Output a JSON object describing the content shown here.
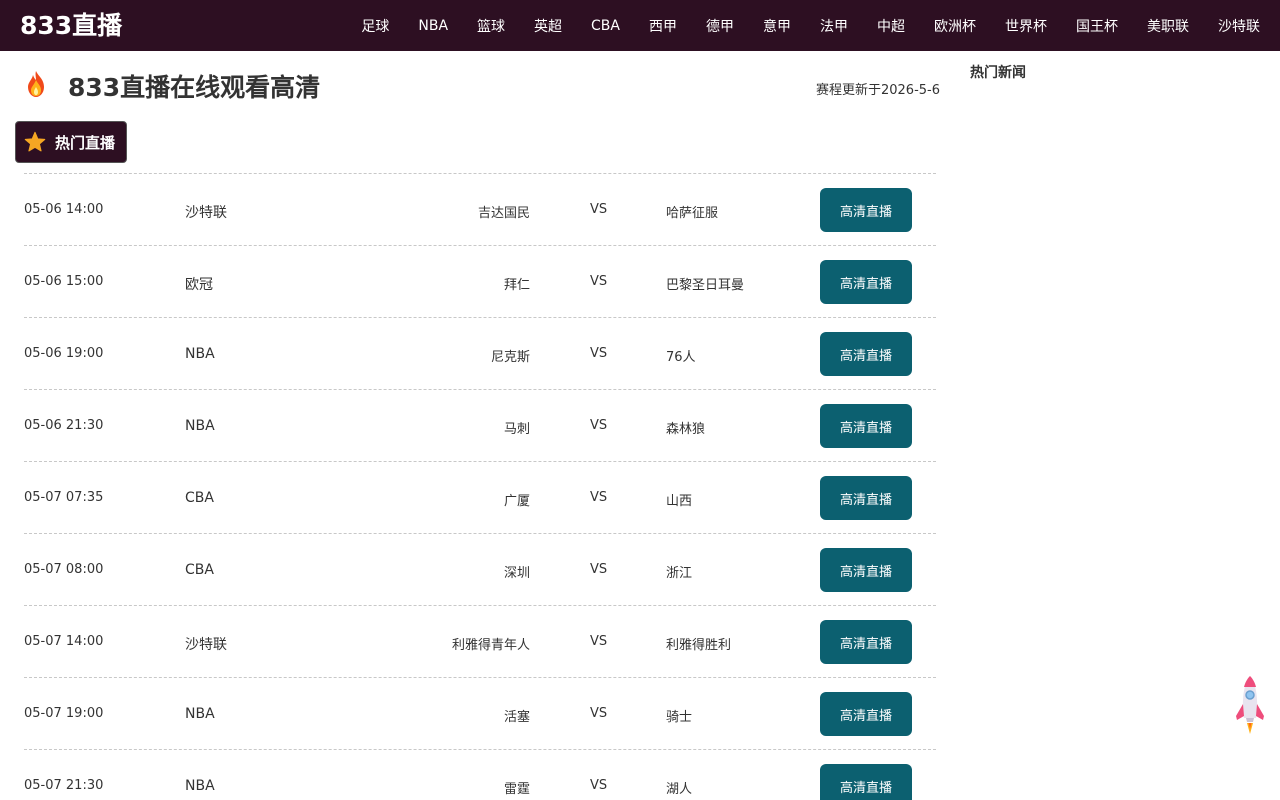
{
  "header": {
    "logo": "833直播",
    "nav": [
      "足球",
      "NBA",
      "篮球",
      "英超",
      "CBA",
      "西甲",
      "德甲",
      "意甲",
      "法甲",
      "中超",
      "欧洲杯",
      "世界杯",
      "国王杯",
      "美职联",
      "沙特联"
    ]
  },
  "main": {
    "title": "833直播在线观看高清",
    "updated": "赛程更新于2026-5-6",
    "section_tab": "热门直播",
    "vs_label": "VS",
    "button_label": "高清直播",
    "matches": [
      {
        "time": "05-06 14:00",
        "league": "沙特联",
        "home": "吉达国民",
        "away": "哈萨征服"
      },
      {
        "time": "05-06 15:00",
        "league": "欧冠",
        "home": "拜仁",
        "away": "巴黎圣日耳曼"
      },
      {
        "time": "05-06 19:00",
        "league": "NBA",
        "home": "尼克斯",
        "away": "76人"
      },
      {
        "time": "05-06 21:30",
        "league": "NBA",
        "home": "马刺",
        "away": "森林狼"
      },
      {
        "time": "05-07 07:35",
        "league": "CBA",
        "home": "广厦",
        "away": "山西"
      },
      {
        "time": "05-07 08:00",
        "league": "CBA",
        "home": "深圳",
        "away": "浙江"
      },
      {
        "time": "05-07 14:00",
        "league": "沙特联",
        "home": "利雅得青年人",
        "away": "利雅得胜利"
      },
      {
        "time": "05-07 19:00",
        "league": "NBA",
        "home": "活塞",
        "away": "骑士"
      },
      {
        "time": "05-07 21:30",
        "league": "NBA",
        "home": "雷霆",
        "away": "湖人"
      }
    ]
  },
  "sidebar": {
    "title": "热门新闻"
  },
  "colors": {
    "header_bg": "#2d0f22",
    "button_bg": "#0c6070",
    "star": "#f5a623"
  },
  "icons": {
    "title": "fire-icon",
    "tab": "star-icon",
    "back_to_top": "rocket-icon"
  }
}
